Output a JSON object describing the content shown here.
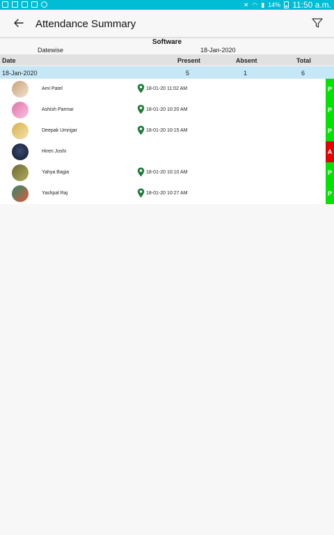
{
  "status_bar": {
    "battery": "14%",
    "time": "11:50 a.m."
  },
  "app_bar": {
    "title": "Attendance Summary",
    "back_icon": "arrow-left-icon",
    "filter_icon": "filter-icon"
  },
  "report": {
    "department": "Software",
    "subheading_left": "Datewise",
    "subheading_right": "18-Jan-2020"
  },
  "table": {
    "headers": {
      "date": "Date",
      "present": "Present",
      "absent": "Absent",
      "total": "Total"
    },
    "summary": {
      "date": "18-Jan-2020",
      "present": "5",
      "absent": "1",
      "total": "6"
    }
  },
  "employees": [
    {
      "name": "Ami Patel",
      "time": "18-01-20 11:02 AM",
      "status": "P",
      "avatar_colors": [
        "#c9a07a",
        "#f1e3d0"
      ]
    },
    {
      "name": "Ashish Parmar",
      "time": "18-01-20 10:20 AM",
      "status": "P",
      "avatar_colors": [
        "#e26fa8",
        "#f6c6df"
      ]
    },
    {
      "name": "Deepak Umrigar",
      "time": "18-01-20 10:15 AM",
      "status": "P",
      "avatar_colors": [
        "#d8b04a",
        "#f3e3b0"
      ]
    },
    {
      "name": "Hiren Joshi",
      "time": "",
      "status": "A",
      "avatar_colors": [
        "#111a2e",
        "#3c4c6e"
      ]
    },
    {
      "name": "Yahya Bagia",
      "time": "18-01-20 10:10 AM",
      "status": "P",
      "avatar_colors": [
        "#6d6a2c",
        "#b0ab62"
      ]
    },
    {
      "name": "Yashpal Raj",
      "time": "18-01-20 10:27 AM",
      "status": "P",
      "avatar_colors": [
        "#2c8a6a",
        "#e05a3c"
      ]
    }
  ],
  "colors": {
    "status_bar": "#00bcd4",
    "present": "#00e400",
    "absent": "#e60000",
    "location_pin": "#1e7a3a",
    "summary_row": "#c6e7f5",
    "header_row": "#e1e1e1"
  }
}
